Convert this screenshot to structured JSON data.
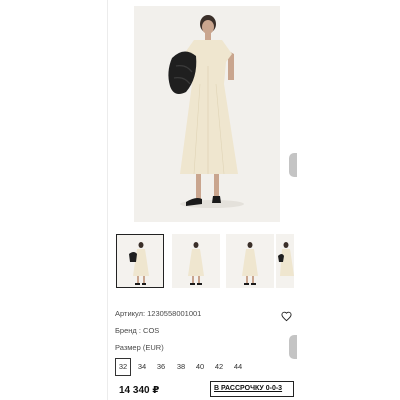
{
  "gallery": {
    "main_image": "model-in-cream-dress-photo",
    "thumbnails": [
      {
        "image": "model-front-photo",
        "selected": true
      },
      {
        "image": "model-side-photo",
        "selected": false
      },
      {
        "image": "model-back-photo",
        "selected": false
      },
      {
        "image": "model-bag-photo",
        "selected": false
      }
    ]
  },
  "product": {
    "sku_text": "Артикул: 1230558001001",
    "brand_text": "Бренд : COS",
    "size_label": "Размер (EUR)",
    "sizes": [
      "32",
      "34",
      "36",
      "38",
      "40",
      "42",
      "44"
    ],
    "selected_size": "32",
    "price": "14 340 ₽",
    "installment_label": "В РАССРОЧКУ 0-0-3"
  },
  "icons": {
    "wishlist": "heart-icon"
  },
  "colors": {
    "dress": "#efe6cf",
    "background": "#ffffff",
    "text": "#222222"
  }
}
